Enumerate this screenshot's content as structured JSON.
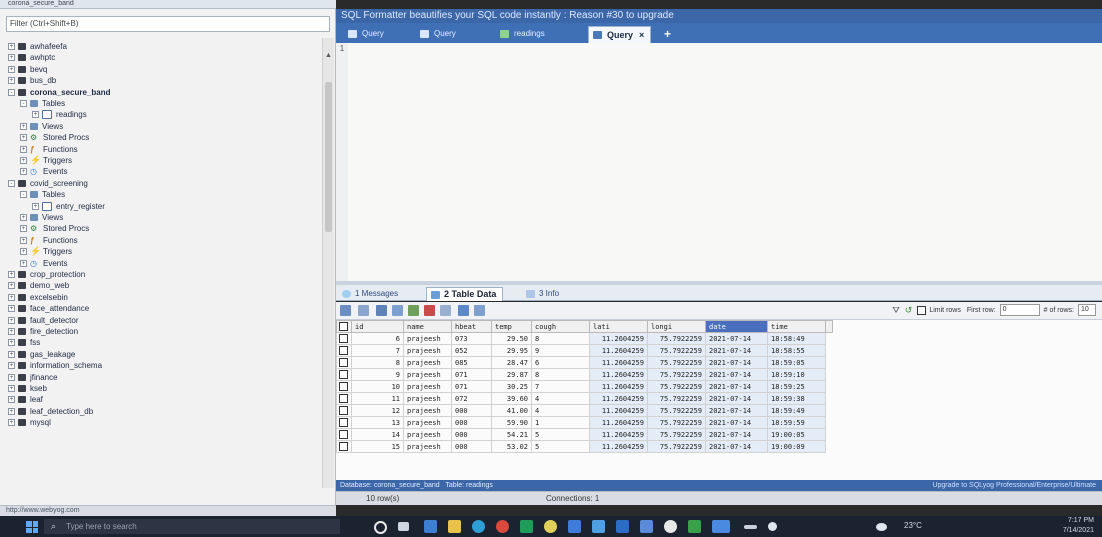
{
  "left_panel": {
    "window_title": "corona_secure_band",
    "filter_placeholder": "Filter (Ctrl+Shift+B)",
    "status_url": "http://www.webyog.com",
    "tree": [
      {
        "label": "awhafeefa",
        "level": 0,
        "sign": "+",
        "icon": "db"
      },
      {
        "label": "awhptc",
        "level": 0,
        "sign": "+",
        "icon": "db"
      },
      {
        "label": "bevq",
        "level": 0,
        "sign": "+",
        "icon": "db"
      },
      {
        "label": "bus_db",
        "level": 0,
        "sign": "+",
        "icon": "db"
      },
      {
        "label": "corona_secure_band",
        "level": 0,
        "sign": "-",
        "icon": "db",
        "bold": true
      },
      {
        "label": "Tables",
        "level": 1,
        "sign": "-",
        "icon": "folder"
      },
      {
        "label": "readings",
        "level": 2,
        "sign": "+",
        "icon": "table"
      },
      {
        "label": "Views",
        "level": 1,
        "sign": "+",
        "icon": "folder"
      },
      {
        "label": "Stored Procs",
        "level": 1,
        "sign": "+",
        "icon": "proc"
      },
      {
        "label": "Functions",
        "level": 1,
        "sign": "+",
        "icon": "func"
      },
      {
        "label": "Triggers",
        "level": 1,
        "sign": "+",
        "icon": "trig"
      },
      {
        "label": "Events",
        "level": 1,
        "sign": "+",
        "icon": "evt"
      },
      {
        "label": "covid_screening",
        "level": 0,
        "sign": "-",
        "icon": "db"
      },
      {
        "label": "Tables",
        "level": 1,
        "sign": "-",
        "icon": "folder"
      },
      {
        "label": "entry_register",
        "level": 2,
        "sign": "+",
        "icon": "table"
      },
      {
        "label": "Views",
        "level": 1,
        "sign": "+",
        "icon": "folder"
      },
      {
        "label": "Stored Procs",
        "level": 1,
        "sign": "+",
        "icon": "proc"
      },
      {
        "label": "Functions",
        "level": 1,
        "sign": "+",
        "icon": "func"
      },
      {
        "label": "Triggers",
        "level": 1,
        "sign": "+",
        "icon": "trig"
      },
      {
        "label": "Events",
        "level": 1,
        "sign": "+",
        "icon": "evt"
      },
      {
        "label": "crop_protection",
        "level": 0,
        "sign": "+",
        "icon": "db"
      },
      {
        "label": "demo_web",
        "level": 0,
        "sign": "+",
        "icon": "db"
      },
      {
        "label": "excelsebin",
        "level": 0,
        "sign": "+",
        "icon": "db"
      },
      {
        "label": "face_attendance",
        "level": 0,
        "sign": "+",
        "icon": "db"
      },
      {
        "label": "fault_detector",
        "level": 0,
        "sign": "+",
        "icon": "db"
      },
      {
        "label": "fire_detection",
        "level": 0,
        "sign": "+",
        "icon": "db"
      },
      {
        "label": "fss",
        "level": 0,
        "sign": "+",
        "icon": "db"
      },
      {
        "label": "gas_leakage",
        "level": 0,
        "sign": "+",
        "icon": "db"
      },
      {
        "label": "information_schema",
        "level": 0,
        "sign": "+",
        "icon": "db"
      },
      {
        "label": "jfinance",
        "level": 0,
        "sign": "+",
        "icon": "db"
      },
      {
        "label": "kseb",
        "level": 0,
        "sign": "+",
        "icon": "db"
      },
      {
        "label": "leaf",
        "level": 0,
        "sign": "+",
        "icon": "db"
      },
      {
        "label": "leaf_detection_db",
        "level": 0,
        "sign": "+",
        "icon": "db"
      },
      {
        "label": "mysql",
        "level": 0,
        "sign": "+",
        "icon": "db"
      }
    ]
  },
  "banner": "SQL Formatter beautifies your SQL code instantly : Reason #30 to upgrade",
  "tabs": [
    {
      "label": "Query",
      "active": false
    },
    {
      "label": "Query",
      "active": false
    },
    {
      "label": "readings",
      "active": false
    },
    {
      "label": "Query",
      "active": true,
      "close": "×"
    }
  ],
  "add_tab": "+",
  "editor": {
    "line_number": "1"
  },
  "result_tabs": [
    {
      "label": "1 Messages",
      "active": false
    },
    {
      "label": "2 Table Data",
      "active": true
    },
    {
      "label": "3 Info",
      "active": false
    }
  ],
  "limit_bar": {
    "limit_rows_label": "Limit rows",
    "first_row_label": "First row:",
    "first_row_value": "0",
    "num_rows_label": "# of rows:",
    "num_rows_value": "10"
  },
  "grid": {
    "columns": [
      "id",
      "name",
      "hbeat",
      "temp",
      "cough",
      "lati",
      "longi",
      "date",
      "time"
    ],
    "highlighted_column": "date",
    "rows": [
      [
        "6",
        "prajeesh",
        "073",
        "29.50",
        "8",
        "11.2604259",
        "75.7922259",
        "2021-07-14",
        "18:58:49"
      ],
      [
        "7",
        "prajeesh",
        "052",
        "29.95",
        "9",
        "11.2604259",
        "75.7922259",
        "2021-07-14",
        "18:58:55"
      ],
      [
        "8",
        "prajeesh",
        "085",
        "28.47",
        "6",
        "11.2604259",
        "75.7922259",
        "2021-07-14",
        "18:59:05"
      ],
      [
        "9",
        "prajeesh",
        "071",
        "29.87",
        "8",
        "11.2604259",
        "75.7922259",
        "2021-07-14",
        "18:59:10"
      ],
      [
        "10",
        "prajeesh",
        "071",
        "30.25",
        "7",
        "11.2604259",
        "75.7922259",
        "2021-07-14",
        "18:59:25"
      ],
      [
        "11",
        "prajeesh",
        "072",
        "39.60",
        "4",
        "11.2604259",
        "75.7922259",
        "2021-07-14",
        "18:59:38"
      ],
      [
        "12",
        "prajeesh",
        "000",
        "41.00",
        "4",
        "11.2604259",
        "75.7922259",
        "2021-07-14",
        "18:59:49"
      ],
      [
        "13",
        "prajeesh",
        "000",
        "59.90",
        "1",
        "11.2604259",
        "75.7922259",
        "2021-07-14",
        "18:59:59"
      ],
      [
        "14",
        "prajeesh",
        "000",
        "54.21",
        "5",
        "11.2604259",
        "75.7922259",
        "2021-07-14",
        "19:00:05"
      ],
      [
        "15",
        "prajeesh",
        "000",
        "53.02",
        "5",
        "11.2604259",
        "75.7922259",
        "2021-07-14",
        "19:00:09"
      ]
    ]
  },
  "db_bar": {
    "database_label": "Database:",
    "database": "corona_secure_band",
    "table_label": "Table:",
    "table": "readings",
    "upgrade_text": "Upgrade to SQLyog Professional/Enterprise/Ultimate"
  },
  "status_bar": {
    "rows": "10 row(s)",
    "connections": "Connections: 1"
  },
  "taskbar": {
    "search_placeholder": "Type here to search",
    "temperature": "23°C",
    "time": "7:17 PM",
    "date": "7/14/2021"
  },
  "colors": {
    "accent": "#3b66a8",
    "highlight_column": "#4a6fbf"
  }
}
